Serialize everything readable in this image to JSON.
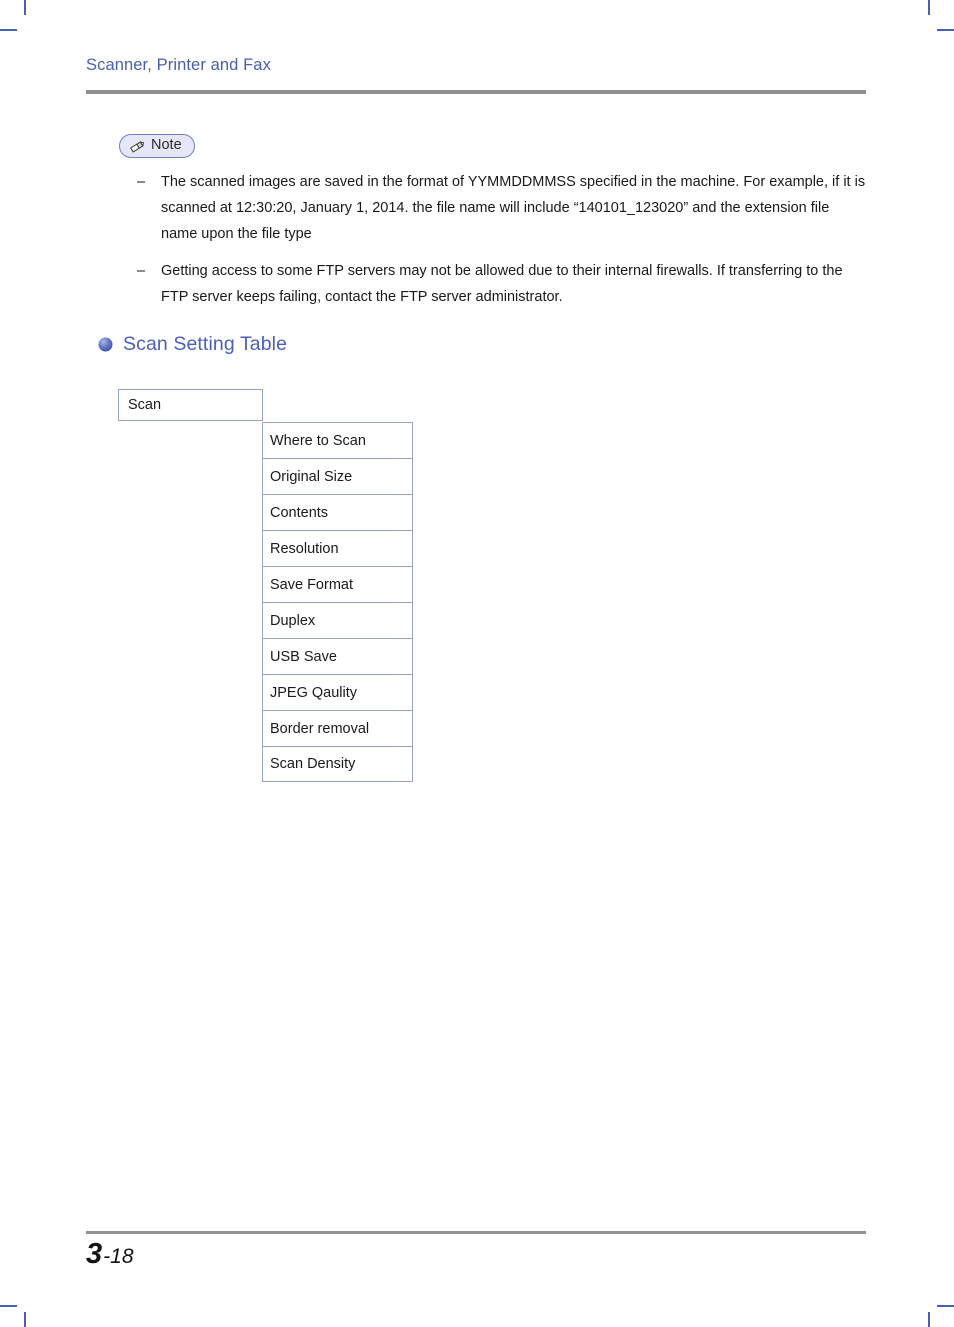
{
  "header": {
    "title": "Scanner, Printer and Fax"
  },
  "note": {
    "badge_label": "Note",
    "badge_icon": "pencil-icon",
    "dash_marker": "–",
    "items": [
      "The scanned images are saved in the format of YYMMDDMMSS specified in the machine.  For example, if it is scanned at 12:30:20, January 1, 2014. the file name will include “140101_123020” and the extension file name upon the file type",
      "Getting access to some FTP servers may not be allowed due to their internal firewalls. If transferring to the FTP server keeps failing, contact the FTP server administrator."
    ]
  },
  "section": {
    "bullet_icon": "sphere-bullet-icon",
    "heading": "Scan Setting Table"
  },
  "scan_table": {
    "group_label": "Scan",
    "settings": [
      "Where to Scan",
      "Original Size",
      "Contents",
      "Resolution",
      "Save Format",
      "Duplex",
      "USB Save",
      "JPEG Qaulity",
      "Border removal",
      "Scan Density"
    ]
  },
  "footer": {
    "chapter": "3",
    "folio": "-18"
  },
  "colors": {
    "accent_blue": "#4a5fbe",
    "header_blue": "#4a5fad",
    "rule_gray": "#919191",
    "table_border": "#9aa3cf",
    "note_fill": "#e6e7f6",
    "crop_mark": "#4a5fad"
  }
}
